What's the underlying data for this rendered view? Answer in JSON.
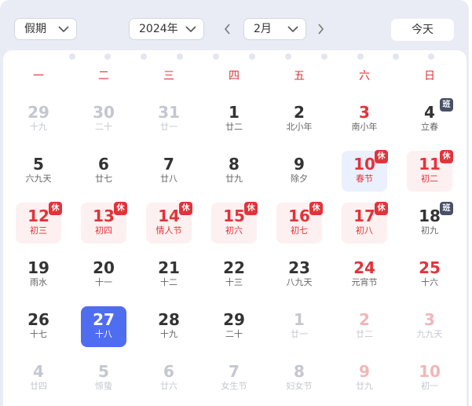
{
  "toolbar": {
    "holiday_select": "假期",
    "year_select": "2024年",
    "month_select": "2月",
    "today_button": "今天"
  },
  "weekdays": [
    "一",
    "二",
    "三",
    "四",
    "五",
    "六",
    "日"
  ],
  "colors": {
    "red": "#e2333a",
    "dark": "#333333",
    "accent": "#4f6df0",
    "badge_rest": "#e2333a",
    "badge_work": "#4a5068"
  },
  "weeks": [
    [
      {
        "day": "29",
        "sub": "十九",
        "state": "other"
      },
      {
        "day": "30",
        "sub": "二十",
        "state": "other"
      },
      {
        "day": "31",
        "sub": "廿一",
        "state": "other"
      },
      {
        "day": "1",
        "sub": "廿二",
        "state": "normal"
      },
      {
        "day": "2",
        "sub": "北小年",
        "state": "normal"
      },
      {
        "day": "3",
        "sub": "南小年",
        "state": "weekend"
      },
      {
        "day": "4",
        "sub": "立春",
        "state": "normal",
        "badge": "班"
      }
    ],
    [
      {
        "day": "5",
        "sub": "六九天",
        "state": "normal"
      },
      {
        "day": "6",
        "sub": "廿七",
        "state": "normal"
      },
      {
        "day": "7",
        "sub": "廿八",
        "state": "normal"
      },
      {
        "day": "8",
        "sub": "廿九",
        "state": "normal"
      },
      {
        "day": "9",
        "sub": "除夕",
        "state": "normal"
      },
      {
        "day": "10",
        "sub": "春节",
        "state": "holiday-blue",
        "badge": "休"
      },
      {
        "day": "11",
        "sub": "初二",
        "state": "holiday",
        "badge": "休"
      }
    ],
    [
      {
        "day": "12",
        "sub": "初三",
        "state": "holiday",
        "badge": "休"
      },
      {
        "day": "13",
        "sub": "初四",
        "state": "holiday",
        "badge": "休"
      },
      {
        "day": "14",
        "sub": "情人节",
        "state": "holiday",
        "badge": "休"
      },
      {
        "day": "15",
        "sub": "初六",
        "state": "holiday",
        "badge": "休"
      },
      {
        "day": "16",
        "sub": "初七",
        "state": "holiday",
        "badge": "休"
      },
      {
        "day": "17",
        "sub": "初八",
        "state": "holiday",
        "badge": "休"
      },
      {
        "day": "18",
        "sub": "初九",
        "state": "normal",
        "badge": "班"
      }
    ],
    [
      {
        "day": "19",
        "sub": "雨水",
        "state": "normal"
      },
      {
        "day": "20",
        "sub": "十一",
        "state": "normal"
      },
      {
        "day": "21",
        "sub": "十二",
        "state": "normal"
      },
      {
        "day": "22",
        "sub": "十三",
        "state": "normal"
      },
      {
        "day": "23",
        "sub": "八九天",
        "state": "normal"
      },
      {
        "day": "24",
        "sub": "元宵节",
        "state": "weekend"
      },
      {
        "day": "25",
        "sub": "十六",
        "state": "weekend"
      }
    ],
    [
      {
        "day": "26",
        "sub": "十七",
        "state": "normal"
      },
      {
        "day": "27",
        "sub": "十八",
        "state": "today"
      },
      {
        "day": "28",
        "sub": "十九",
        "state": "normal"
      },
      {
        "day": "29",
        "sub": "二十",
        "state": "normal"
      },
      {
        "day": "1",
        "sub": "廿一",
        "state": "other"
      },
      {
        "day": "2",
        "sub": "廿二",
        "state": "other-weekend"
      },
      {
        "day": "3",
        "sub": "九九天",
        "state": "other-weekend"
      }
    ],
    [
      {
        "day": "4",
        "sub": "廿四",
        "state": "other"
      },
      {
        "day": "5",
        "sub": "惊蛰",
        "state": "other"
      },
      {
        "day": "6",
        "sub": "廿六",
        "state": "other"
      },
      {
        "day": "7",
        "sub": "女生节",
        "state": "other"
      },
      {
        "day": "8",
        "sub": "妇女节",
        "state": "other"
      },
      {
        "day": "9",
        "sub": "廿九",
        "state": "other-weekend"
      },
      {
        "day": "10",
        "sub": "初一",
        "state": "other-weekend"
      }
    ]
  ]
}
